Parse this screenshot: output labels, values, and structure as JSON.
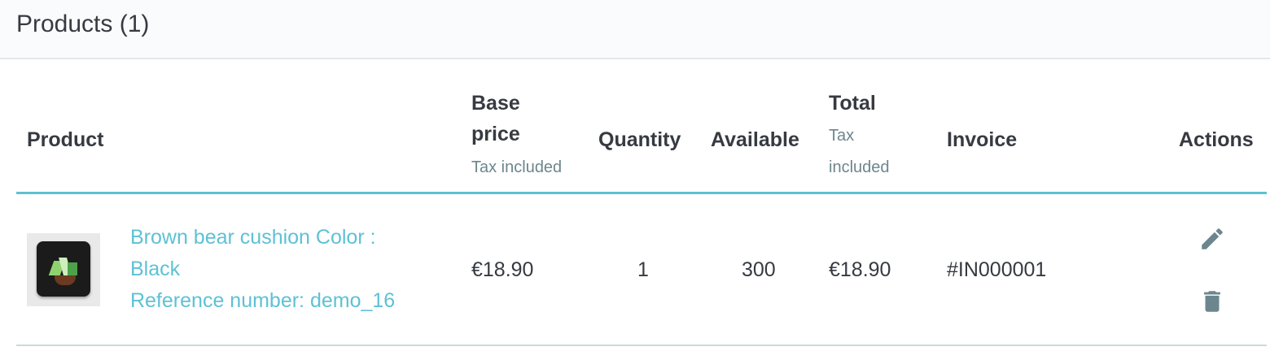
{
  "panel": {
    "title": "Products (1)"
  },
  "table": {
    "headers": {
      "product": "Product",
      "base_price_line1": "Base",
      "base_price_line2": "price",
      "base_price_sub": "Tax included",
      "quantity": "Quantity",
      "available": "Available",
      "total": "Total",
      "total_sub_line1": "Tax",
      "total_sub_line2": "included",
      "invoice": "Invoice",
      "actions": "Actions"
    },
    "rows": [
      {
        "name_line1": "Brown bear cushion Color :",
        "name_line2": "Black",
        "reference": "Reference number: demo_16",
        "base_price": "€18.90",
        "quantity": "1",
        "available": "300",
        "total": "€18.90",
        "invoice": "#IN000001",
        "actions": {
          "edit_icon": "pencil-icon",
          "delete_icon": "trash-icon"
        }
      }
    ]
  },
  "colors": {
    "accent": "#5ec1d4",
    "text": "#363a41",
    "muted": "#6c868e",
    "icon": "#6c868e"
  }
}
